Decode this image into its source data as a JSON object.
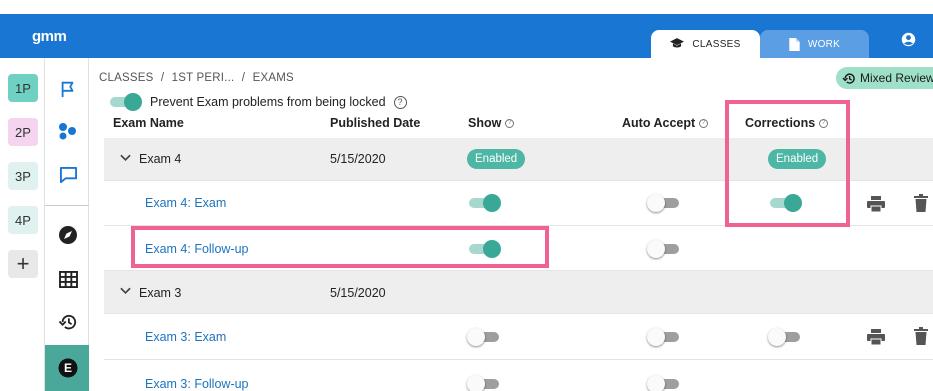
{
  "app": {
    "brand": "gmm"
  },
  "tabs": [
    {
      "label": "CLASSES",
      "active": true
    },
    {
      "label": "WORK",
      "active": false
    }
  ],
  "periods": [
    "1P",
    "2P",
    "3P",
    "4P",
    "+"
  ],
  "nav_icons": [
    "flag-icon",
    "molecule-icon",
    "chat-icon",
    "compass-icon",
    "grid-icon",
    "history-icon",
    "exam-icon"
  ],
  "active_nav": "E",
  "breadcrumb": {
    "root": "CLASSES",
    "sep": "/",
    "period": "1ST PERI...",
    "current": "EXAMS"
  },
  "mixed_review": {
    "label": "Mixed Review"
  },
  "prevent_lock": {
    "label": "Prevent Exam problems from being locked",
    "on": true
  },
  "columns": {
    "name": "Exam Name",
    "date": "Published Date",
    "show": "Show",
    "auto": "Auto Accept",
    "corrections": "Corrections"
  },
  "help_glyph": "?",
  "groups": [
    {
      "name": "Exam 4",
      "date": "5/15/2020",
      "show_badge": "Enabled",
      "corrections_badge": "Enabled",
      "items": [
        {
          "name": "Exam 4: Exam",
          "show": true,
          "auto": false,
          "corrections": true,
          "actions": true
        },
        {
          "name": "Exam 4: Follow-up",
          "show": true,
          "auto": false,
          "corrections": null,
          "actions": false
        }
      ]
    },
    {
      "name": "Exam 3",
      "date": "5/15/2020",
      "items": [
        {
          "name": "Exam 3: Exam",
          "show": false,
          "auto": false,
          "corrections": false,
          "actions": true
        },
        {
          "name": "Exam 3: Follow-up",
          "show": false,
          "auto": false,
          "corrections": null,
          "actions": false
        }
      ]
    }
  ],
  "colors": {
    "primary": "#1976d2",
    "teal": "#4db6a4",
    "highlight": "#f06292",
    "link": "#1e73be"
  }
}
